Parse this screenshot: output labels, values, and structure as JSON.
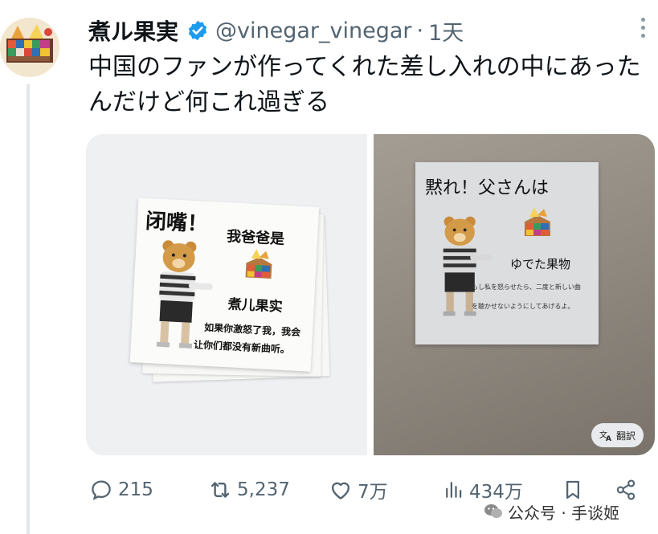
{
  "user": {
    "display_name": "煮ル果実",
    "handle": "@vinegar_vinegar",
    "separator": "·",
    "time": "1天"
  },
  "tweet": {
    "text": "中国のファンが作ってくれた差し入れの中にあったんだけど何これ過ぎる"
  },
  "media": {
    "left_sticker": {
      "title1": "闭嘴！",
      "title2": "我爸爸是",
      "name": "煮儿果实",
      "line1": "如果你激怒了我，我会",
      "line2": "让你们都没有新曲听。"
    },
    "right_sticker": {
      "title": "黙れ！父さんは",
      "name": "ゆでた果物",
      "line1": "もし私を怒らせたら、二度と新しい曲",
      "line2": "を聴かせないようにしてあげるよ。"
    },
    "translate_label": "翻訳"
  },
  "actions": {
    "replies": "215",
    "reposts": "5,237",
    "likes": "7万",
    "views": "434万"
  },
  "watermark": {
    "text": "公众号 · 手谈姬"
  },
  "colors": {
    "verified": "#1d9bf0",
    "muted": "#536471"
  }
}
